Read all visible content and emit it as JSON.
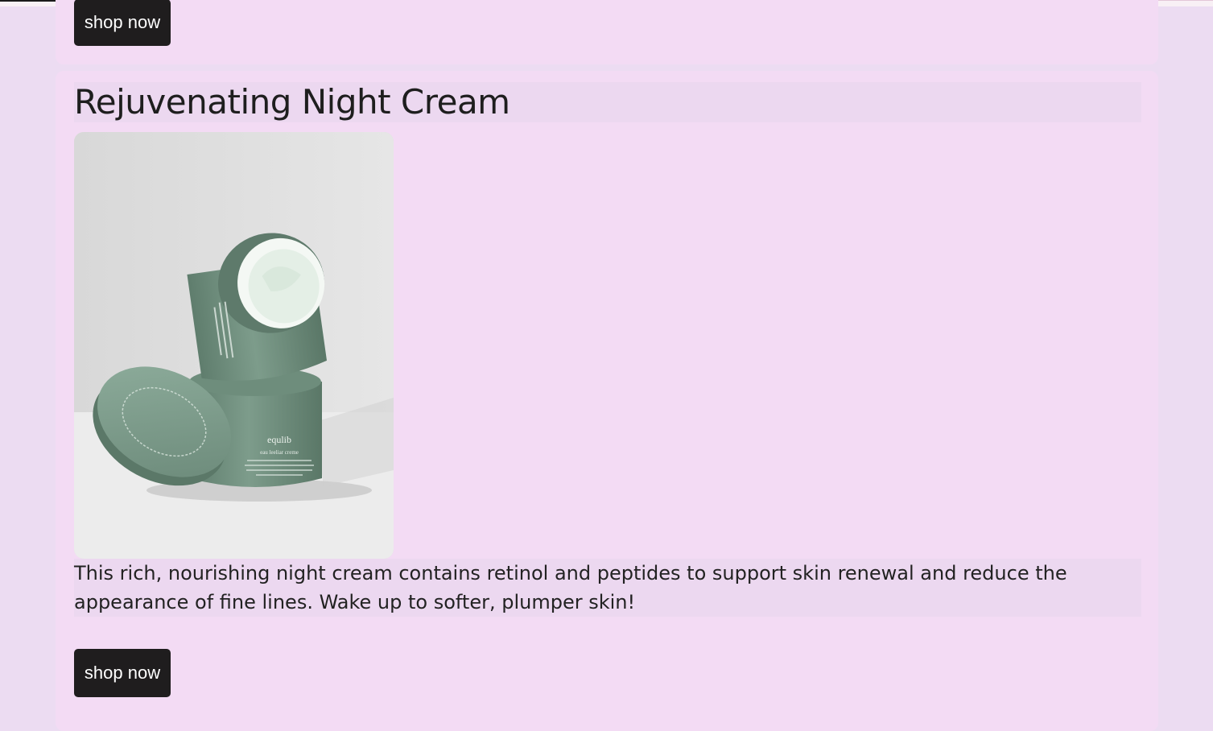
{
  "previous_card": {
    "button_label": "shop now"
  },
  "product": {
    "title": "Rejuvenating Night Cream",
    "image_alt": "Green equlib cream jars with lid",
    "jar_brand": "equlib",
    "jar_name": "eau leeliar creme",
    "description": "This rich, nourishing night cream contains retinol and peptides to support skin renewal and reduce the appearance of fine lines. Wake up to softer, plumper skin!",
    "button_label": "shop now"
  },
  "colors": {
    "page_background": "#ecdcf2",
    "card_background": "#f3dbf4",
    "button_background": "#1f1d1e",
    "button_text": "#ffffff",
    "jar_green": "#7a9a88"
  },
  "icons": {
    "product_photo": "cream-jar-image"
  }
}
